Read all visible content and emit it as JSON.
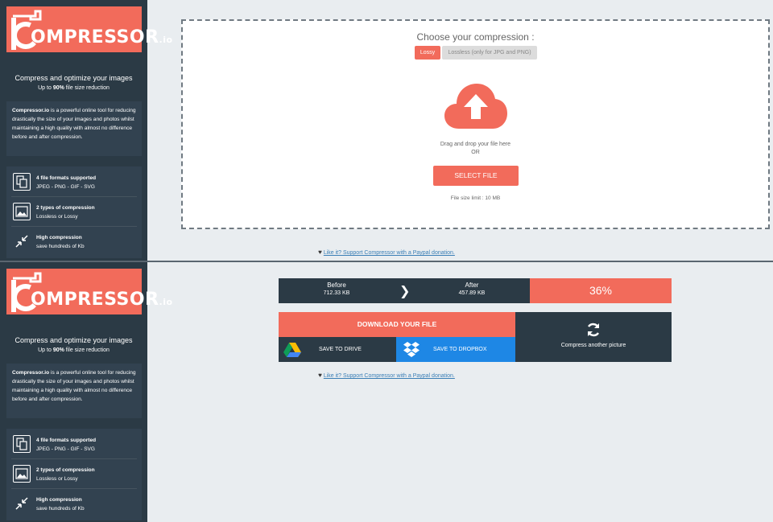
{
  "brand": {
    "logo_text": "OMPRESSOR",
    "logo_suffix": ".io",
    "accent": "#f26b5b",
    "sidebar_bg": "#2b3a45"
  },
  "sidebar": {
    "tagline": "Compress and optimize your images",
    "tagline_sub_prefix": "Up to ",
    "tagline_sub_bold": "90%",
    "tagline_sub_suffix": " file size reduction",
    "desc_bold": "Compressor.io",
    "desc_rest": " is a powerful online tool for reducing drastically the size of your images and photos whilst maintaining a high quality with almost no difference before and after compression.",
    "features": [
      {
        "icon": "files-icon",
        "title": "4 file formats supported",
        "sub": "JPEG - PNG - GIF - SVG"
      },
      {
        "icon": "image-icon",
        "title": "2 types of compression",
        "sub": "Lossless or Lossy"
      },
      {
        "icon": "compress-arrows-icon",
        "title": "High compression",
        "sub": "save hundreds of Kb"
      }
    ]
  },
  "upload": {
    "choose_title": "Choose your compression :",
    "lossy_label": "Lossy",
    "lossless_label": "Lossless (only for JPG and PNG)",
    "drag_text": "Drag and drop your file here",
    "or_text": "OR",
    "select_label": "SELECT FILE",
    "limit_text": "File size limit : 10 MB"
  },
  "donate": {
    "text": "Like it? Support Compressor with a Paypal donation."
  },
  "result": {
    "before_label": "Before",
    "before_value": "712.33 KB",
    "after_label": "After",
    "after_value": "457.89 KB",
    "percent": "36%",
    "download_label": "DOWNLOAD YOUR FILE",
    "drive_label": "SAVE TO DRIVE",
    "dropbox_label": "SAVE TO DROPBOX",
    "another_label": "Compress another picture"
  }
}
